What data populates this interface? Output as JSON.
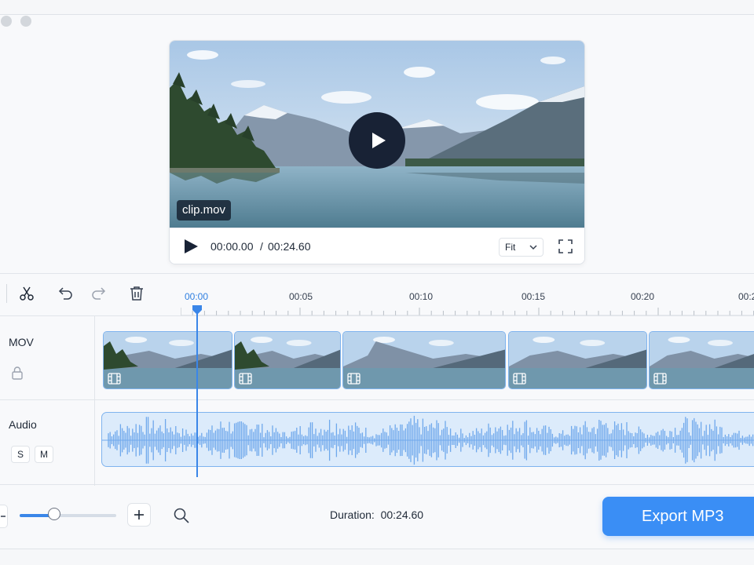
{
  "preview": {
    "clip_label": "clip.mov",
    "current_time": "00:00.00",
    "separator": "/",
    "total_time": "00:24.60",
    "fit_label": "Fit"
  },
  "timeline": {
    "ticks": [
      "00:00",
      "00:05",
      "00:10",
      "00:15",
      "00:20",
      "00:2"
    ],
    "playhead_time": "00:00"
  },
  "tracks": {
    "video": {
      "name": "MOV",
      "clip_count": 5
    },
    "audio": {
      "name": "Audio",
      "solo_label": "S",
      "mute_label": "M"
    }
  },
  "bottom": {
    "zoom_level": 0.36,
    "duration_label": "Duration:",
    "duration_value": "00:24.60",
    "export_label": "Export MP3"
  },
  "colors": {
    "accent": "#3a8ef5",
    "playhead": "#3a86e8",
    "clip_border": "#7fb3ee",
    "waveform": "#6fa8ec"
  },
  "icons": {
    "tools": [
      "scissors-icon",
      "undo-icon",
      "redo-icon",
      "trash-icon"
    ],
    "preview": [
      "play-icon",
      "chevron-down-icon",
      "fullscreen-icon"
    ],
    "tracks": [
      "lock-icon",
      "film-icon"
    ],
    "bottom": [
      "minus-icon",
      "plus-icon",
      "search-icon"
    ]
  }
}
